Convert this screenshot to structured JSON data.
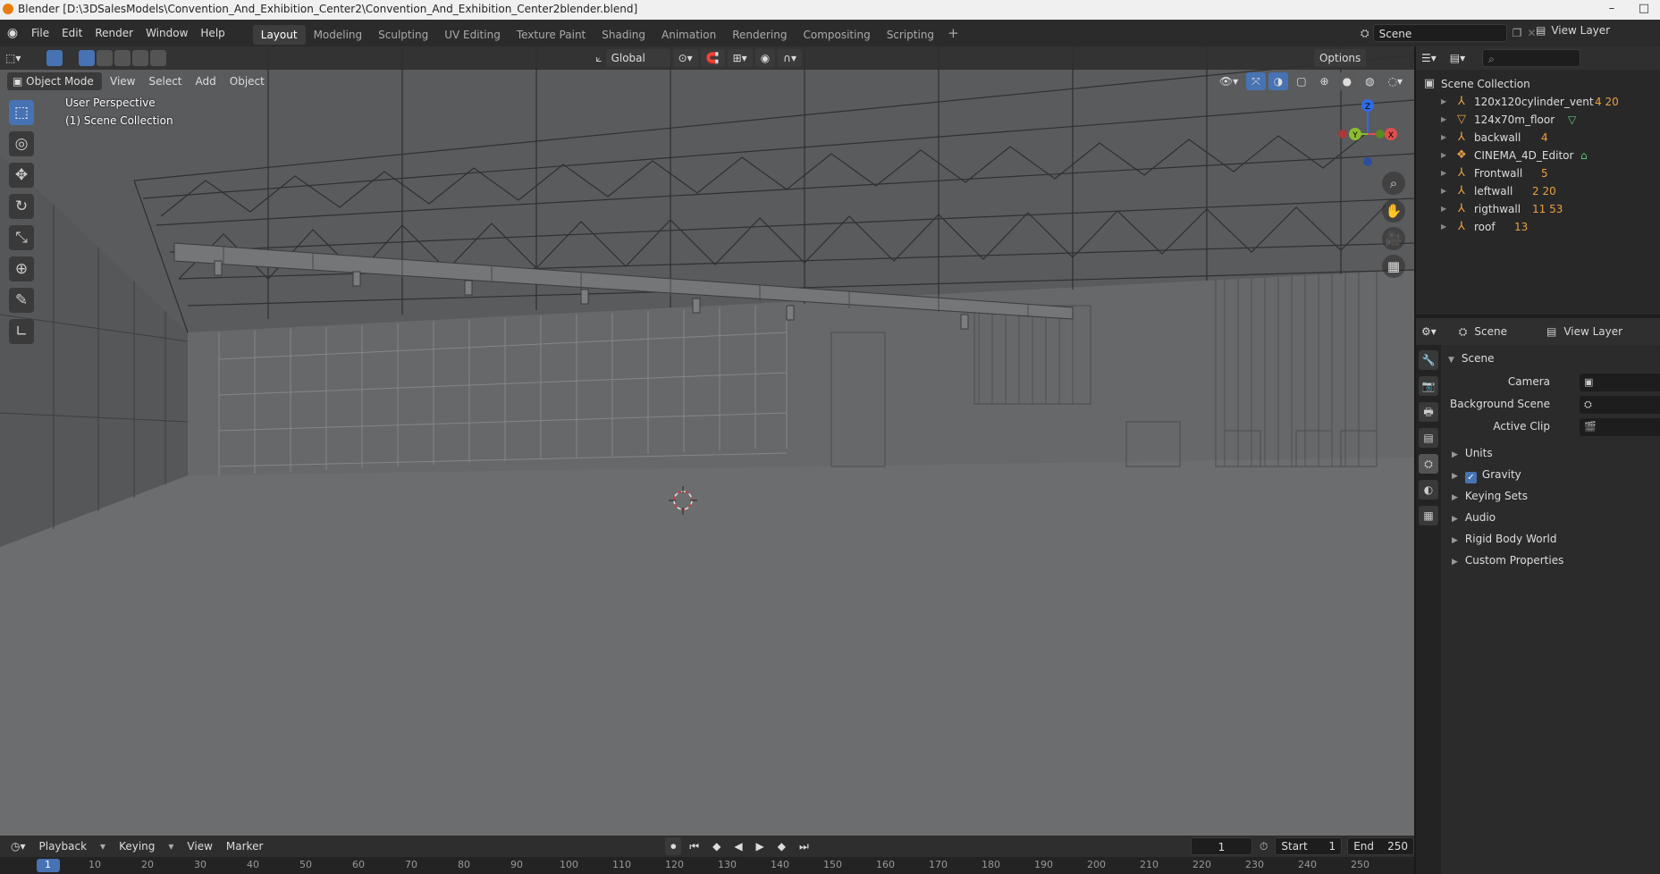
{
  "window": {
    "title": "Blender [D:\\3DSalesModels\\Convention_And_Exhibition_Center2\\Convention_And_Exhibition_Center2blender.blend]",
    "controls": [
      "–",
      "□"
    ]
  },
  "menu": [
    "File",
    "Edit",
    "Render",
    "Window",
    "Help"
  ],
  "workspaces": {
    "tabs": [
      "Layout",
      "Modeling",
      "Sculpting",
      "UV Editing",
      "Texture Paint",
      "Shading",
      "Animation",
      "Rendering",
      "Compositing",
      "Scripting"
    ],
    "active": "Layout",
    "add": "+"
  },
  "scene_selector": {
    "value": "Scene"
  },
  "view_layer_selector": {
    "value": "View Layer"
  },
  "viewport": {
    "mode": "Object Mode",
    "menus": [
      "View",
      "Select",
      "Add",
      "Object"
    ],
    "transform_orientation": "Global",
    "options_label": "Options",
    "perspective_label": "User Perspective",
    "collection_label": "(1) Scene Collection",
    "gizmo": {
      "z": "Z",
      "y": "Y",
      "x": "X"
    },
    "colors": {
      "background": "#5e5f61",
      "floor": "#6e6e70",
      "wire": "#2e2e2e",
      "active_tool": "#4772b3"
    }
  },
  "tools": [
    {
      "name": "select-box-tool",
      "glyph": "⬚",
      "active": true
    },
    {
      "name": "cursor-tool",
      "glyph": "◎",
      "active": false
    },
    {
      "name": "move-tool",
      "glyph": "✥",
      "active": false
    },
    {
      "name": "rotate-tool",
      "glyph": "↻",
      "active": false
    },
    {
      "name": "scale-tool",
      "glyph": "⤡",
      "active": false
    },
    {
      "name": "transform-tool",
      "glyph": "⊕",
      "active": false
    },
    {
      "name": "annotate-tool",
      "glyph": "✎",
      "active": false
    },
    {
      "name": "measure-tool",
      "glyph": "📐",
      "active": false
    }
  ],
  "outliner": {
    "root": "Scene Collection",
    "items": [
      {
        "name": "120x120cylinder_vent",
        "badge": "4 20"
      },
      {
        "name": "124x70m_floor",
        "badge": ""
      },
      {
        "name": "backwall",
        "badge": "4"
      },
      {
        "name": "CINEMA_4D_Editor",
        "badge": ""
      },
      {
        "name": "Frontwall",
        "badge": "5"
      },
      {
        "name": "leftwall",
        "badge": "2 20"
      },
      {
        "name": "rigthwall",
        "badge": "11 53"
      },
      {
        "name": "roof",
        "badge": "13"
      }
    ]
  },
  "properties": {
    "header_scene": "Scene",
    "header_view_layer": "View Layer",
    "section_title": "Scene",
    "fields": [
      "Camera",
      "Background Scene",
      "Active Clip"
    ],
    "subsections": [
      "Units",
      "Gravity",
      "Keying Sets",
      "Audio",
      "Rigid Body World",
      "Custom Properties"
    ],
    "gravity_checked": "✓"
  },
  "timeline": {
    "menus": [
      "Playback",
      "Keying",
      "View",
      "Marker"
    ],
    "current_frame": "1",
    "start_label": "Start",
    "start_value": "1",
    "end_label": "End",
    "end_value": "250",
    "ruler": [
      "1",
      "10",
      "20",
      "30",
      "40",
      "50",
      "60",
      "70",
      "80",
      "90",
      "100",
      "110",
      "120",
      "130",
      "140",
      "150",
      "160",
      "170",
      "180",
      "190",
      "200",
      "210",
      "220",
      "230",
      "240",
      "250"
    ]
  }
}
